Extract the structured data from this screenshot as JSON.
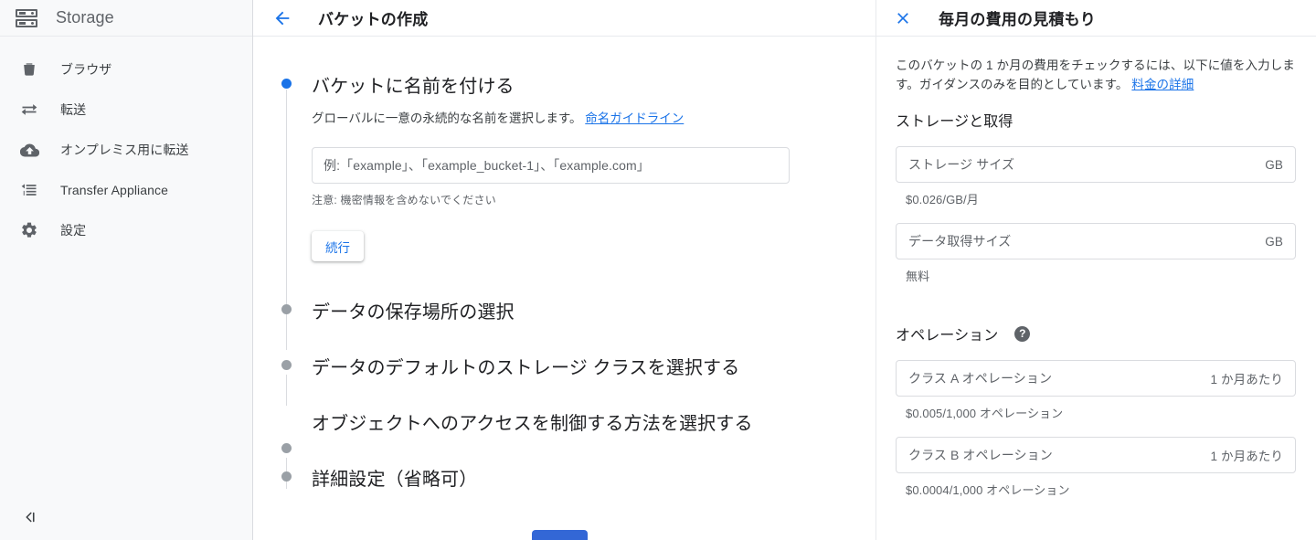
{
  "sidebar": {
    "brand": {
      "icon": "storage-rack-icon",
      "title": "Storage"
    },
    "items": [
      {
        "icon": "bucket-icon",
        "label": "ブラウザ"
      },
      {
        "icon": "transfer-arrows-icon",
        "label": "転送"
      },
      {
        "icon": "cloud-upload-icon",
        "label": "オンプレミス用に転送"
      },
      {
        "icon": "transfer-appliance-icon",
        "label": "Transfer Appliance"
      },
      {
        "icon": "gear-icon",
        "label": "設定"
      }
    ],
    "collapse": {
      "icon": "collapse-panel-icon",
      "label": "<|"
    }
  },
  "main": {
    "header": {
      "back_icon": "arrow-left-icon",
      "title": "バケットの作成"
    },
    "steps": [
      {
        "title": "バケットに名前を付ける",
        "active": true,
        "description_text": "グローバルに一意の永続的な名前を選択します。",
        "description_link": "命名ガイドライン",
        "input_placeholder": "例:「example」、「example_bucket-1」、「example.com」",
        "hint": "注意: 機密情報を含めないでください",
        "continue_label": "続行"
      },
      {
        "title": "データの保存場所の選択",
        "active": false
      },
      {
        "title": "データのデフォルトのストレージ クラスを選択する",
        "active": false
      },
      {
        "title": "オブジェクトへのアクセスを制御する方法を選択する",
        "active": false
      },
      {
        "title": "詳細設定（省略可）",
        "active": false
      }
    ]
  },
  "right_panel": {
    "header": {
      "close_icon": "close-icon",
      "title": "毎月の費用の見積もり"
    },
    "intro_text": "このバケットの 1 か月の費用をチェックするには、以下に値を入力します。ガイダンスのみを目的としています。",
    "intro_link": "料金の詳細",
    "sections": [
      {
        "title": "ストレージと取得",
        "has_help": false,
        "fields": [
          {
            "placeholder": "ストレージ サイズ",
            "suffix": "GB",
            "note": "$0.026/GB/月"
          },
          {
            "placeholder": "データ取得サイズ",
            "suffix": "GB",
            "note": "無料"
          }
        ]
      },
      {
        "title": "オペレーション",
        "has_help": true,
        "help_icon": "help-circle-icon",
        "fields": [
          {
            "placeholder": "クラス A オペレーション",
            "suffix": "1 か月あたり",
            "note": "$0.005/1,000 オペレーション"
          },
          {
            "placeholder": "クラス B オペレーション",
            "suffix": "1 か月あたり",
            "note": "$0.0004/1,000 オペレーション"
          }
        ]
      }
    ]
  },
  "colors": {
    "accent": "#1a73e8",
    "button_blue": "#3367d6",
    "sidebar_bg": "#f8f9fa",
    "border": "#dadce0",
    "text_primary": "#202124",
    "text_secondary": "#5f6368",
    "bullet_inactive": "#9aa0a6"
  }
}
